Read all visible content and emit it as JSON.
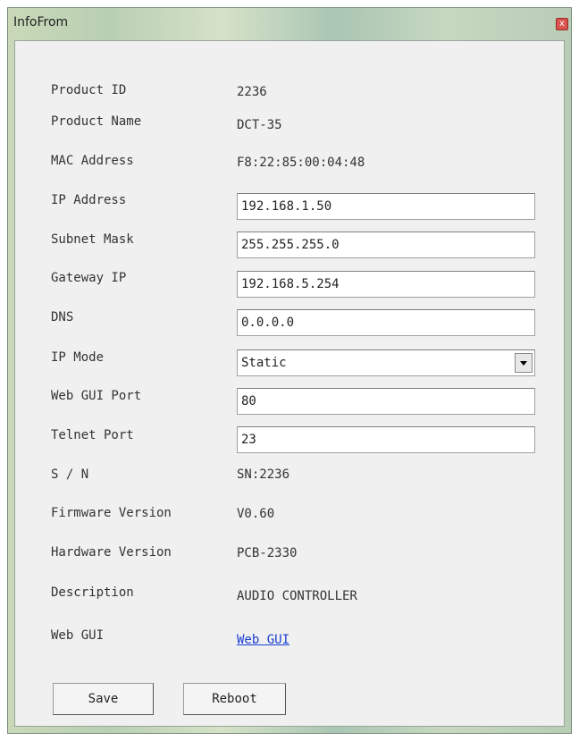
{
  "window": {
    "title": "InfoFrom",
    "close_symbol": "x"
  },
  "fields": {
    "product_id": {
      "label": "Product ID",
      "value": "2236"
    },
    "product_name": {
      "label": "Product Name",
      "value": "DCT-35"
    },
    "mac_address": {
      "label": "MAC Address",
      "value": "F8:22:85:00:04:48"
    },
    "ip_address": {
      "label": "IP Address",
      "value": "192.168.1.50"
    },
    "subnet_mask": {
      "label": "Subnet Mask",
      "value": "255.255.255.0"
    },
    "gateway_ip": {
      "label": "Gateway IP",
      "value": "192.168.5.254"
    },
    "dns": {
      "label": "DNS",
      "value": "0.0.0.0"
    },
    "ip_mode": {
      "label": "IP Mode",
      "value": "Static"
    },
    "web_gui_port": {
      "label": "Web GUI Port",
      "value": "80"
    },
    "telnet_port": {
      "label": "Telnet Port",
      "value": "23"
    },
    "serial_number": {
      "label": "S / N",
      "value": "SN:2236"
    },
    "firmware_version": {
      "label": "Firmware Version",
      "value": "V0.60"
    },
    "hardware_version": {
      "label": "Hardware Version",
      "value": "PCB-2330"
    },
    "description": {
      "label": "Description",
      "value": "AUDIO CONTROLLER"
    },
    "web_gui": {
      "label": "Web GUI",
      "link_text": "Web GUI"
    }
  },
  "buttons": {
    "save": "Save",
    "reboot": "Reboot"
  },
  "icons": {
    "close": "close-icon",
    "dropdown": "chevron-down-icon"
  }
}
